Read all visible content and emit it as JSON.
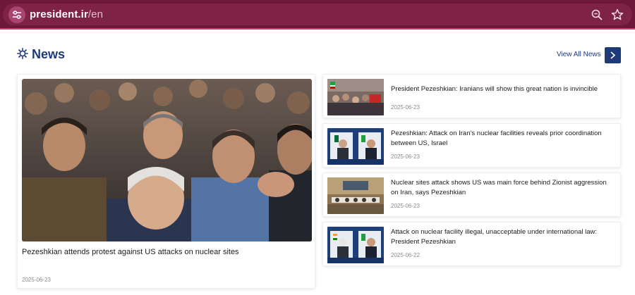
{
  "browser": {
    "url_host": "president.ir",
    "url_path": "/en",
    "colors": {
      "bar": "#6d1838",
      "pill": "#7e2346"
    },
    "icons": [
      "tune-icon",
      "zoom-icon",
      "star-icon"
    ]
  },
  "header": {
    "title": "News",
    "view_all_label": "View All News",
    "icons": [
      "sun-icon",
      "chevron-right-icon"
    ],
    "accent_color": "#1e3a7b"
  },
  "featured": {
    "title": "Pezeshkian attends protest against US attacks on nuclear sites",
    "date": "2025-06-23"
  },
  "items": [
    {
      "title": "President Pezeshkian: Iranians will show this great nation is invincible",
      "date": "2025-06-23"
    },
    {
      "title": "Pezeshkian: Attack on Iran’s nuclear facilities reveals prior coordination between US, Israel",
      "date": "2025-06-23"
    },
    {
      "title": "Nuclear sites attack shows US was main force behind Zionist aggression on Iran, says Pezeshkian",
      "date": "2025-06-23"
    },
    {
      "title": "Attack on nuclear facility illegal, unacceptable under international law: President Pezeshkian",
      "date": "2025-06-22"
    }
  ]
}
